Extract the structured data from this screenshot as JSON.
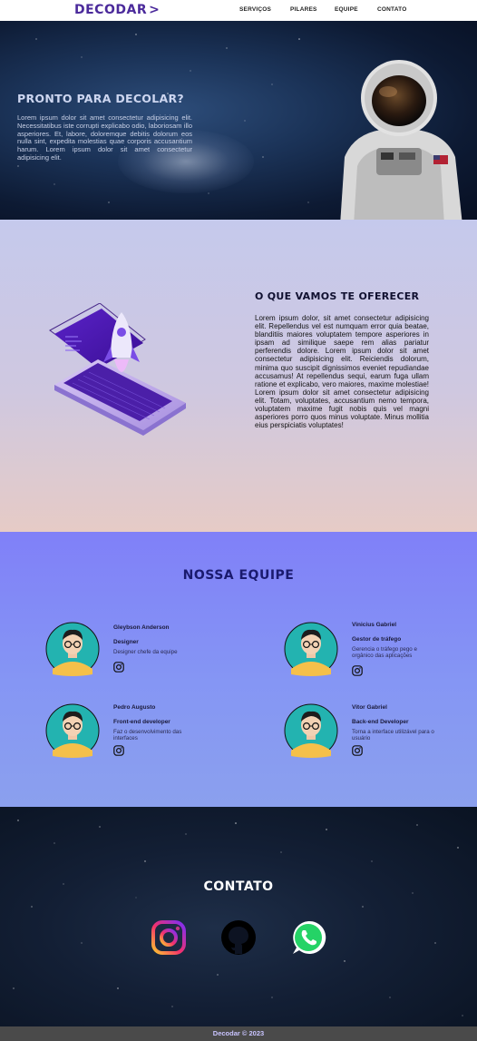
{
  "header": {
    "logo": "DECODAR",
    "logo_arrow": ">",
    "nav": [
      "SERVIÇOS",
      "PILARES",
      "EQUIPE",
      "CONTATO"
    ]
  },
  "hero": {
    "title": "PRONTO PARA DECOLAR?",
    "text": "Lorem ipsum dolor sit amet consectetur adipisicing elit. Necessitatibus iste corrupti explicabo odio, laboriosam illo asperiores. Et, labore, doloremque debitis dolorum eos nulla sint, expedita molestias quae corporis accusantium harum. Lorem ipsum dolor sit amet consectetur adipisicing elit."
  },
  "services": {
    "title": "O QUE VAMOS TE OFERECER",
    "text": "Lorem ipsum dolor, sit amet consectetur adipisicing elit. Repellendus vel est numquam error quia beatae, blanditiis maiores voluptatem tempore asperiores in ipsam ad similique saepe rem alias pariatur perferendis dolore. Lorem ipsum dolor sit amet consectetur adipisicing elit. Reiciendis dolorum, minima quo suscipit dignissimos eveniet repudiandae accusamus! At repellendus sequi, earum fuga ullam ratione et explicabo, vero maiores, maxime molestiae! Lorem ipsum dolor sit amet consectetur adipisicing elit. Totam, voluptates, accusantium nemo tempora, voluptatem maxime fugit nobis quis vel magni asperiores porro quos minus voluptate. Minus mollitia eius perspiciatis voluptates!"
  },
  "team": {
    "title": "NOSSA EQUIPE",
    "members": [
      {
        "name": "Gleybson Anderson",
        "role": "Designer",
        "desc": "Designer chefe da equipe"
      },
      {
        "name": "Vinicius Gabriel",
        "role": "Gestor de tráfego",
        "desc": "Gerencia o tráfego pego e orgânico das aplicações"
      },
      {
        "name": "Pedro Augusto",
        "role": "Front-end developer",
        "desc": "Faz o desenvolvimento das interfaces"
      },
      {
        "name": "Vitor Gabriel",
        "role": "Back-end Developer",
        "desc": "Torna a interface utilizável para o usuário"
      }
    ]
  },
  "contact": {
    "title": "CONTATO",
    "icons": [
      "instagram-icon",
      "github-icon",
      "whatsapp-icon"
    ]
  },
  "footer": {
    "text": "Decodar  ©  2023"
  },
  "colors": {
    "brand": "#4b2a9b",
    "team_bg": "#8080f8",
    "team_title": "#1a1a6e",
    "footer_bg": "#4a4a4a",
    "footer_text": "#c9c4ff"
  }
}
